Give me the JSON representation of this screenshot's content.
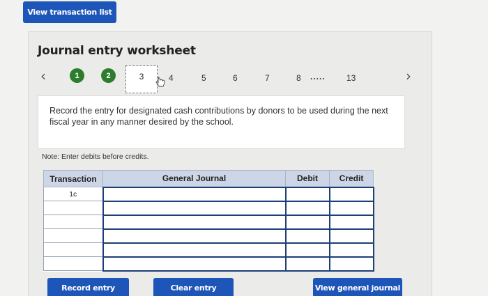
{
  "header": {
    "view_list_label": "View transaction list"
  },
  "worksheet": {
    "title": "Journal entry worksheet",
    "steps": [
      "1",
      "2",
      "3",
      "4",
      "5",
      "6",
      "7",
      "8",
      ".....",
      "13"
    ],
    "current_step": "3",
    "instruction": "Record the entry for designated cash contributions by donors to be used during the next fiscal year in any manner desired by the school.",
    "note": "Note: Enter debits before credits."
  },
  "table": {
    "headers": {
      "transaction": "Transaction",
      "journal": "General Journal",
      "debit": "Debit",
      "credit": "Credit"
    },
    "rows": [
      {
        "transaction": "1c"
      },
      {
        "transaction": ""
      },
      {
        "transaction": ""
      },
      {
        "transaction": ""
      },
      {
        "transaction": ""
      },
      {
        "transaction": ""
      }
    ]
  },
  "actions": {
    "record_label": "Record entry",
    "clear_label": "Clear entry",
    "view_journal_label": "View general journal"
  },
  "colors": {
    "button_blue": "#1e55b8",
    "step_done_green": "#2e7d2e",
    "header_bg": "#cdd6e6"
  }
}
